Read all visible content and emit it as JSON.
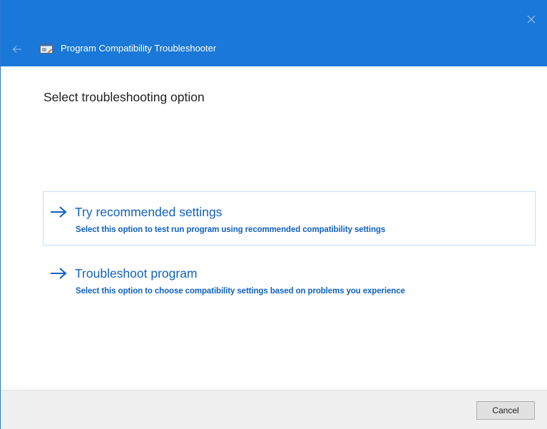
{
  "window": {
    "title": "Program Compatibility Troubleshooter",
    "accent_color": "#1a78d8",
    "icons": {
      "back": "back-arrow-icon",
      "close": "close-icon",
      "app": "troubleshooter-app-icon"
    }
  },
  "main": {
    "heading": "Select troubleshooting option",
    "options": [
      {
        "title": "Try recommended settings",
        "description": "Select this option to test run program using recommended compatibility settings",
        "icon": "arrow-right-icon",
        "highlighted": true
      },
      {
        "title": "Troubleshoot program",
        "description": "Select this option to choose compatibility settings based on problems you experience",
        "icon": "arrow-right-icon",
        "highlighted": false
      }
    ],
    "link_color": "#1060c4"
  },
  "footer": {
    "cancel_label": "Cancel"
  }
}
